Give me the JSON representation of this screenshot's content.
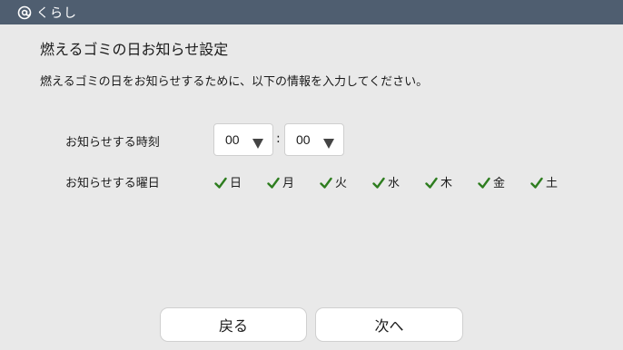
{
  "app": {
    "title": "くらし",
    "icon": "at-sign-icon"
  },
  "page": {
    "title": "燃えるゴミの日お知らせ設定",
    "description": "燃えるゴミの日をお知らせするために、以下の情報を入力してください。"
  },
  "time": {
    "label": "お知らせする時刻",
    "hour": "00",
    "minute": "00",
    "separator": ":"
  },
  "days": {
    "label": "お知らせする曜日",
    "items": [
      {
        "label": "日",
        "checked": true
      },
      {
        "label": "月",
        "checked": true
      },
      {
        "label": "火",
        "checked": true
      },
      {
        "label": "水",
        "checked": true
      },
      {
        "label": "木",
        "checked": true
      },
      {
        "label": "金",
        "checked": true
      },
      {
        "label": "土",
        "checked": true
      }
    ]
  },
  "buttons": {
    "back": "戻る",
    "next": "次へ"
  },
  "colors": {
    "topbar": "#4f5e70",
    "background": "#e9e9e9",
    "check": "#2e7d1f"
  }
}
